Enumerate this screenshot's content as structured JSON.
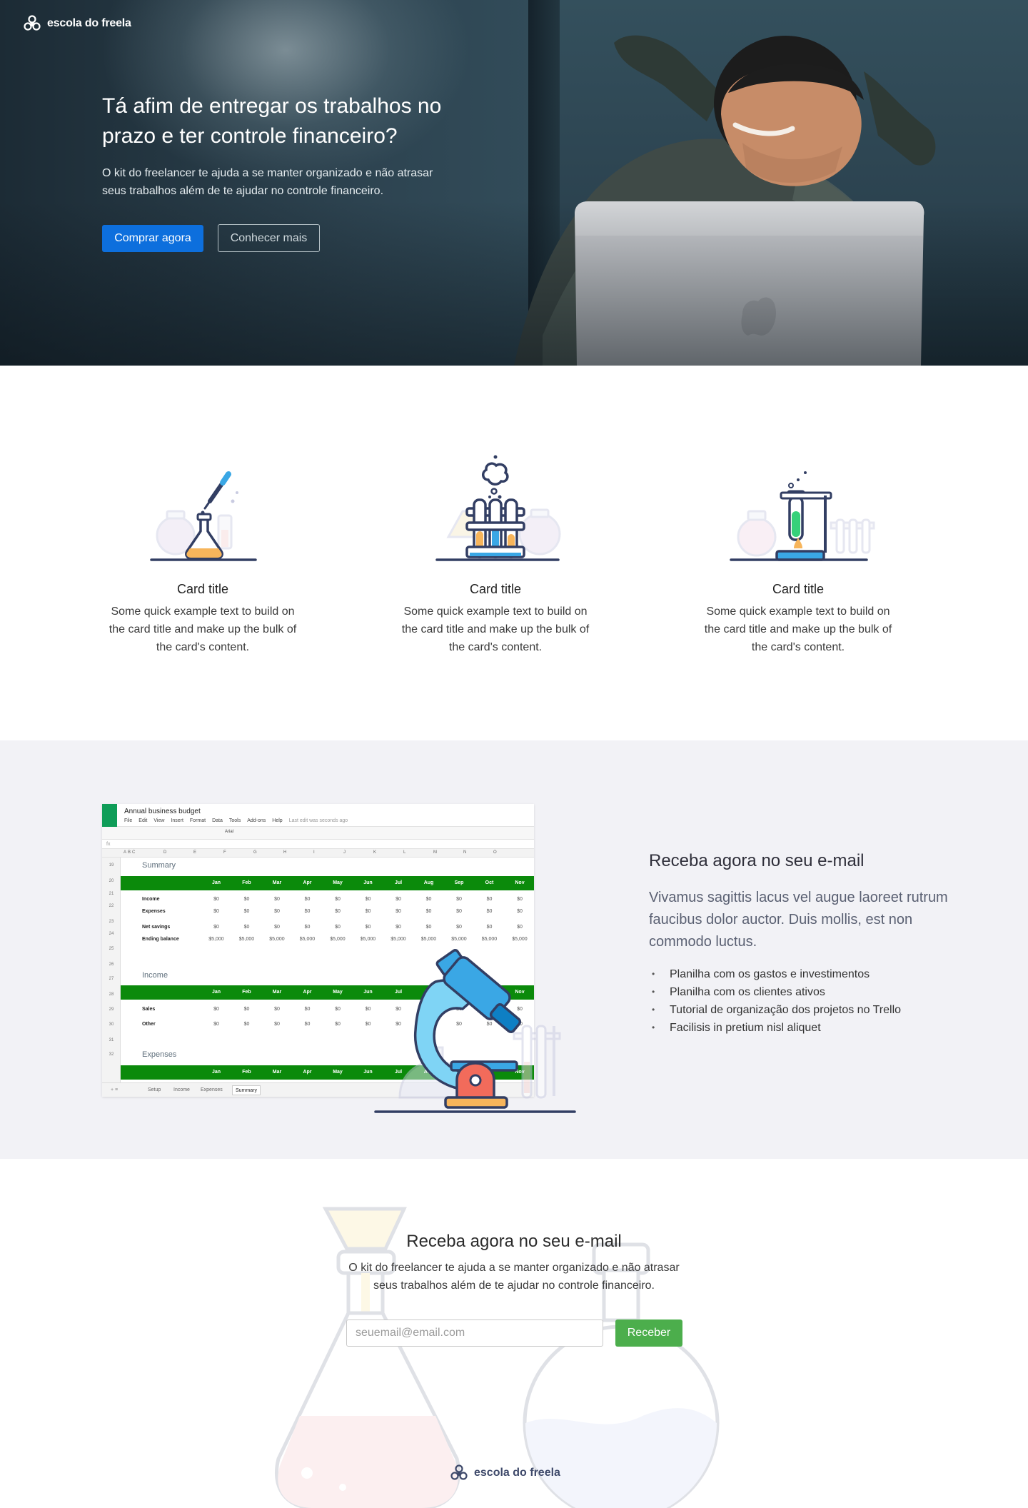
{
  "brand": {
    "name": "escola do freela",
    "logo_icon": "network-logo-icon"
  },
  "hero": {
    "title": "Tá afim de entregar os trabalhos no prazo e ter controle financeiro?",
    "text": "O kit do freelancer te ajuda a se manter organizado e não atrasar seus trabalhos além de te ajudar no controle financeiro.",
    "primary_button": "Comprar agora",
    "secondary_button": "Conhecer mais"
  },
  "features": [
    {
      "icon": "flask-dropper-icon",
      "title": "Card title",
      "text": "Some quick example text to build on the card title and make up the bulk of the card's content."
    },
    {
      "icon": "test-tubes-icon",
      "title": "Card title",
      "text": "Some quick example text to build on the card title and make up the bulk of the card's content."
    },
    {
      "icon": "burner-tube-icon",
      "title": "Card title",
      "text": "Some quick example text to build on the card title and make up the bulk of the card's content."
    }
  ],
  "spreadsheet": {
    "doc_title": "Annual business budget",
    "menus": [
      "File",
      "Edit",
      "View",
      "Insert",
      "Format",
      "Data",
      "Tools",
      "Add-ons",
      "Help"
    ],
    "last_edit": "Last edit was seconds ago",
    "font": "Arial",
    "col_letters": [
      "A",
      "B",
      "C",
      "D",
      "E",
      "F",
      "G",
      "H",
      "I",
      "J",
      "K",
      "L",
      "M",
      "N",
      "O"
    ],
    "row_numbers": [
      "19",
      "20",
      "21",
      "22",
      "23",
      "24",
      "25",
      "26",
      "27",
      "28",
      "29",
      "30",
      "31",
      "32"
    ],
    "months": [
      "Jan",
      "Feb",
      "Mar",
      "Apr",
      "May",
      "Jun",
      "Jul",
      "Aug",
      "Sep",
      "Oct",
      "Nov"
    ],
    "summary": {
      "title": "Summary",
      "rows": [
        {
          "label": "Income",
          "value": "$0"
        },
        {
          "label": "Expenses",
          "value": "$0"
        },
        {
          "label": "Net savings",
          "value": "$0"
        },
        {
          "label": "Ending balance",
          "value": "$5,000"
        }
      ]
    },
    "income": {
      "title": "Income",
      "rows": [
        {
          "label": "Sales",
          "value": "$0"
        },
        {
          "label": "Other",
          "value": "$0"
        }
      ]
    },
    "expenses": {
      "title": "Expenses"
    },
    "tabs": [
      "Setup",
      "Income",
      "Expenses",
      "Summary"
    ],
    "active_tab": "Summary",
    "colors": {
      "header_green": "#0b8a0b",
      "sheets_icon": "#0f9d58"
    }
  },
  "email_section": {
    "heading": "Receba agora no seu e-mail",
    "lead": "Vivamus sagittis lacus vel augue laoreet rutrum faucibus dolor auctor. Duis mollis, est non commodo luctus.",
    "list": [
      "Planilha com os gastos e investimentos",
      "Planilha com os clientes ativos",
      "Tutorial de organização dos projetos no Trello",
      "Facilisis in pretium nisl aliquet"
    ]
  },
  "subscribe": {
    "heading": "Receba agora no seu e-mail",
    "text": "O kit do freelancer te ajuda a se manter organizado e não atrasar seus trabalhos além de te ajudar no controle financeiro.",
    "placeholder": "seuemail@email.com",
    "button": "Receber"
  },
  "footer": {
    "brand": "escola do freela"
  },
  "colors": {
    "primary": "#0d6fdd",
    "success": "#4cae4c",
    "hero_bg": "#2d4350",
    "section_bg": "#f2f2f6"
  }
}
